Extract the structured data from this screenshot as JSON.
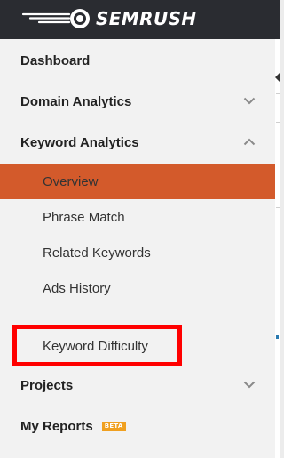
{
  "header": {
    "brand": "SEMRUSH",
    "logo_icon": "semrush-fireball-icon"
  },
  "sidebar": {
    "items": [
      {
        "label": "Dashboard"
      },
      {
        "label": "Domain Analytics",
        "expanded": false
      },
      {
        "label": "Keyword Analytics",
        "expanded": true,
        "children": [
          {
            "label": "Overview",
            "active": true
          },
          {
            "label": "Phrase Match"
          },
          {
            "label": "Related Keywords"
          },
          {
            "label": "Ads History"
          },
          {
            "label": "Keyword Difficulty",
            "highlighted": true
          }
        ]
      },
      {
        "label": "Projects",
        "expanded": false
      },
      {
        "label": "My Reports",
        "badge": "BETA"
      }
    ]
  },
  "colors": {
    "header_bg": "#2a2c31",
    "sidebar_bg": "#f2f2f2",
    "active_item_bg": "#d35a2b",
    "badge_bg": "#f0a020",
    "highlight_border": "#ff0000"
  }
}
